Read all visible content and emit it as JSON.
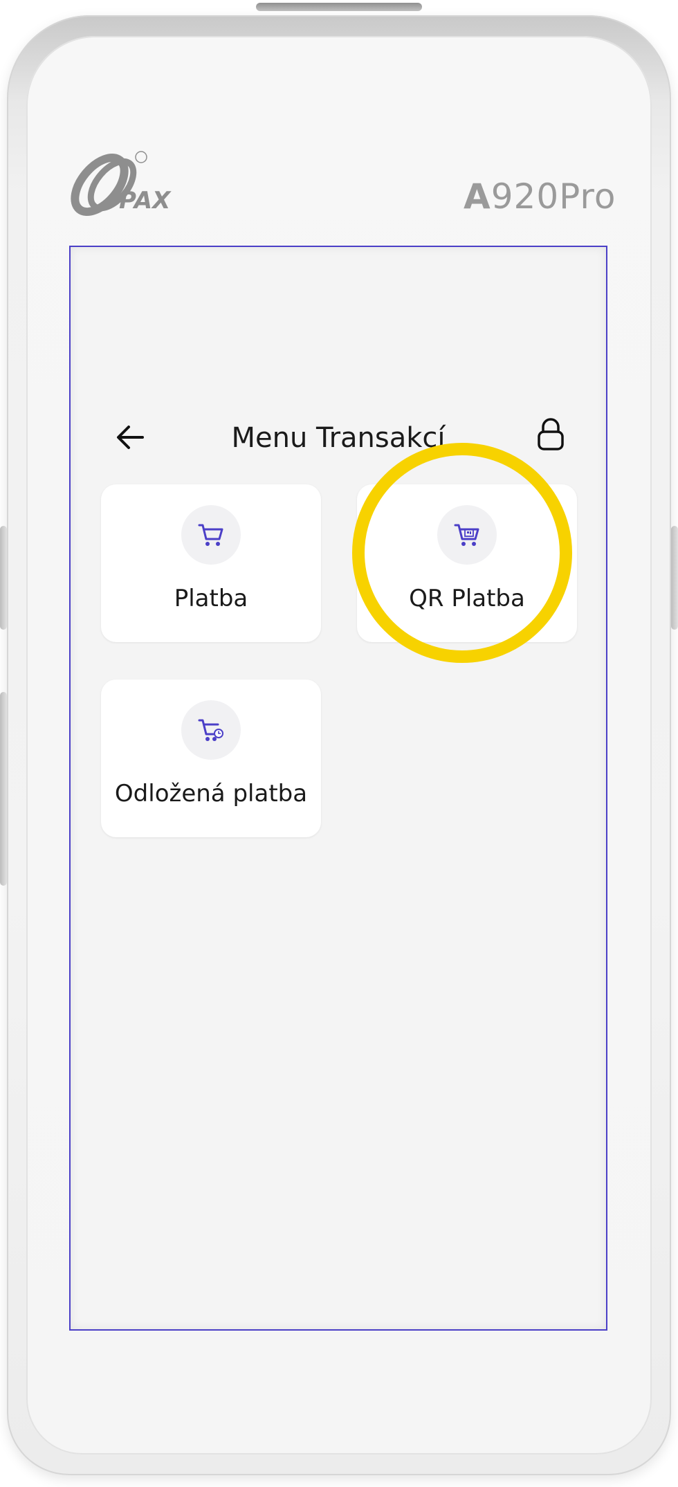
{
  "device": {
    "brand": "PAX",
    "model_prefix": "A",
    "model_rest": "920Pro"
  },
  "header": {
    "title": "Menu Transakcí"
  },
  "tiles": [
    {
      "label": "Platba",
      "icon": "cart-icon"
    },
    {
      "label": "QR Platba",
      "icon": "qr-cart-icon"
    },
    {
      "label": "Odložená platba",
      "icon": "deferred-cart-icon"
    }
  ],
  "colors": {
    "accent": "#4b3fc7",
    "highlight": "#f7d200",
    "tile_bg": "#ffffff",
    "screen_bg": "#f4f4f4"
  }
}
